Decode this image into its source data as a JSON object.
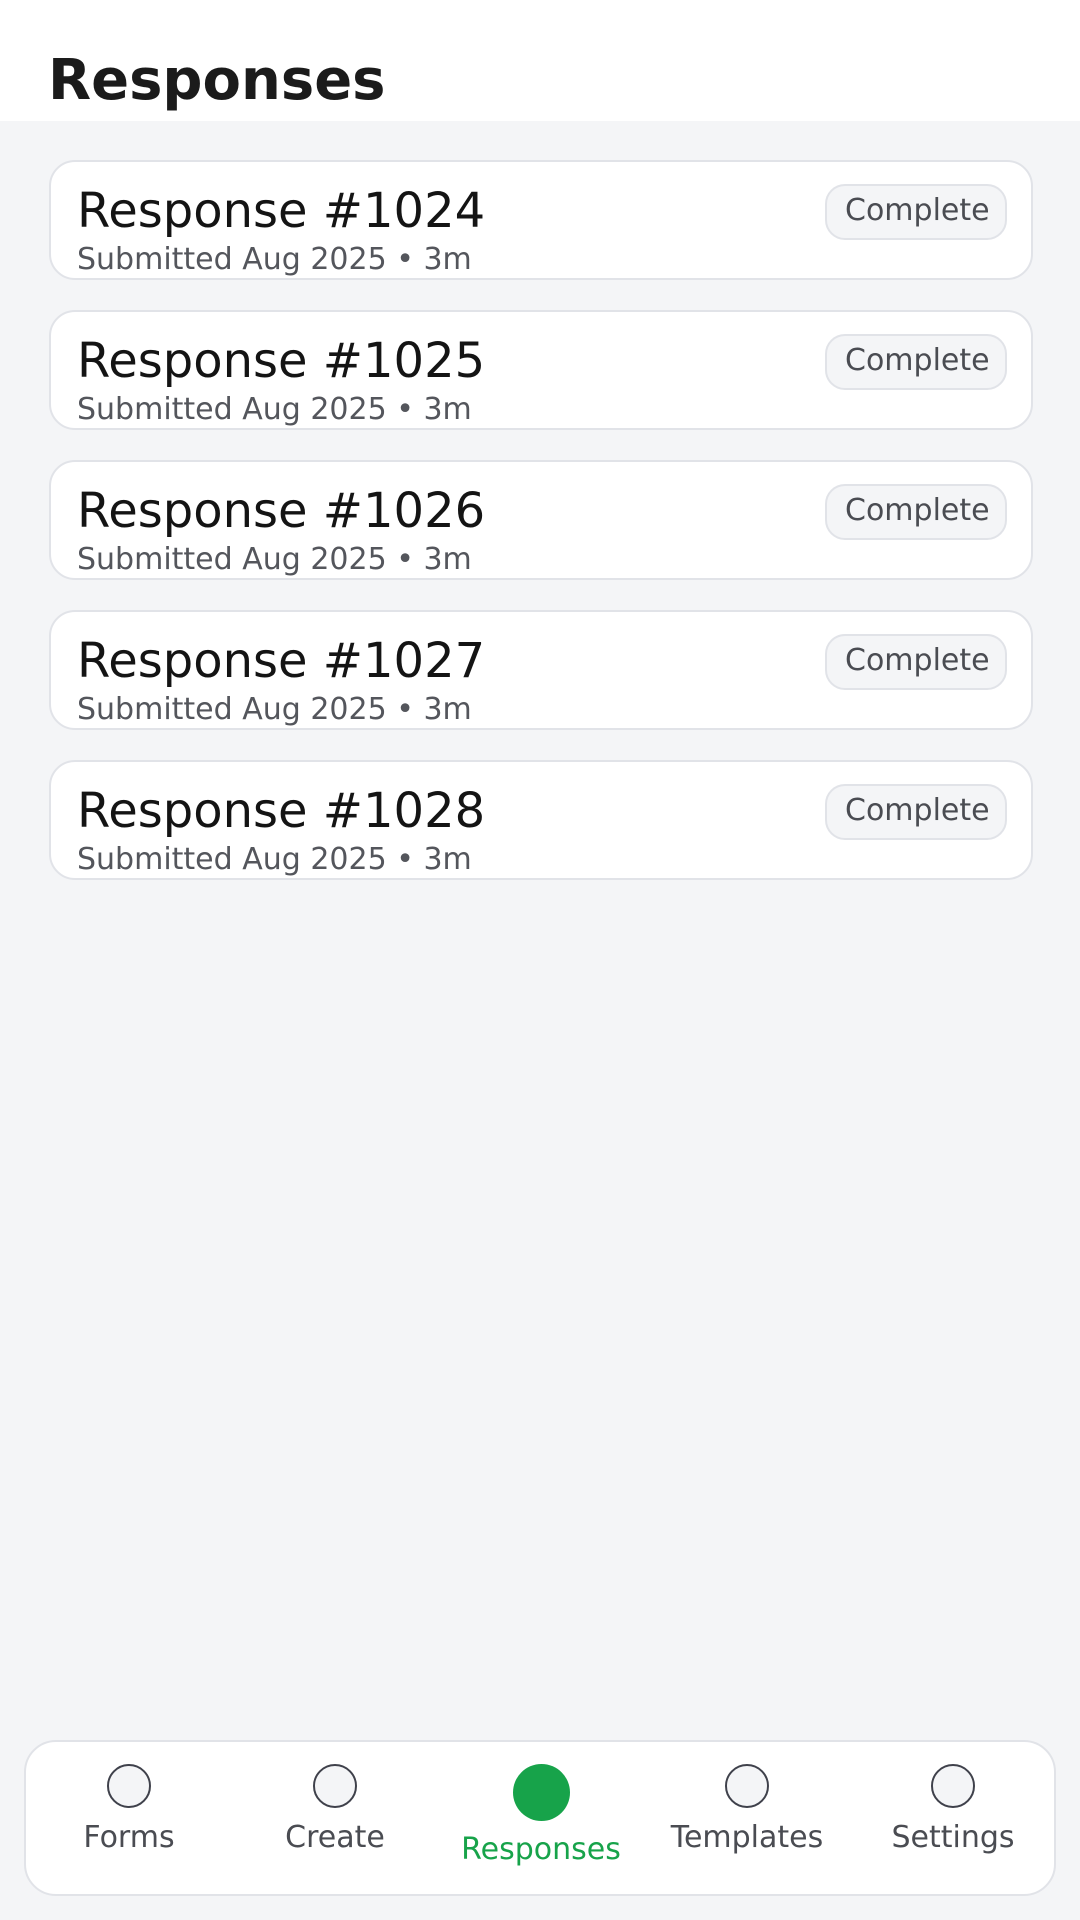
{
  "header": {
    "title": "Responses"
  },
  "responses": [
    {
      "title": "Response #1024",
      "subtitle": "Submitted Aug 2025 • 3m",
      "status": "Complete"
    },
    {
      "title": "Response #1025",
      "subtitle": "Submitted Aug 2025 • 3m",
      "status": "Complete"
    },
    {
      "title": "Response #1026",
      "subtitle": "Submitted Aug 2025 • 3m",
      "status": "Complete"
    },
    {
      "title": "Response #1027",
      "subtitle": "Submitted Aug 2025 • 3m",
      "status": "Complete"
    },
    {
      "title": "Response #1028",
      "subtitle": "Submitted Aug 2025 • 3m",
      "status": "Complete"
    }
  ],
  "tabbar": {
    "active_tab": "Responses",
    "active_color": "#17a34a",
    "tabs": [
      {
        "label": "Forms",
        "icon": "circle-outline-icon"
      },
      {
        "label": "Create",
        "icon": "circle-outline-icon"
      },
      {
        "label": "Responses",
        "icon": "circle-filled-icon"
      },
      {
        "label": "Templates",
        "icon": "circle-outline-icon"
      },
      {
        "label": "Settings",
        "icon": "circle-outline-icon"
      }
    ]
  }
}
